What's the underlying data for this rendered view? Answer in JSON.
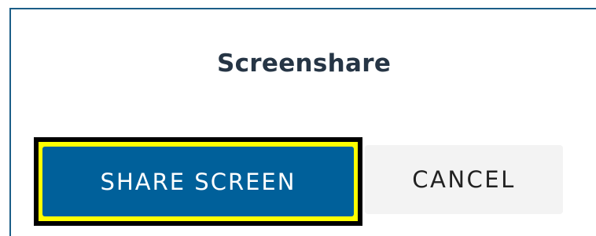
{
  "dialog": {
    "title": "Screenshare",
    "buttons": {
      "share_label": "SHARE SCREEN",
      "cancel_label": "CANCEL"
    }
  },
  "colors": {
    "dialog_border": "#1b5e87",
    "title_text": "#263545",
    "primary_button": "#00609a",
    "secondary_button": "#f3f3f3",
    "focus_ring_outer": "#000000",
    "focus_ring_inner": "#ffff00"
  }
}
